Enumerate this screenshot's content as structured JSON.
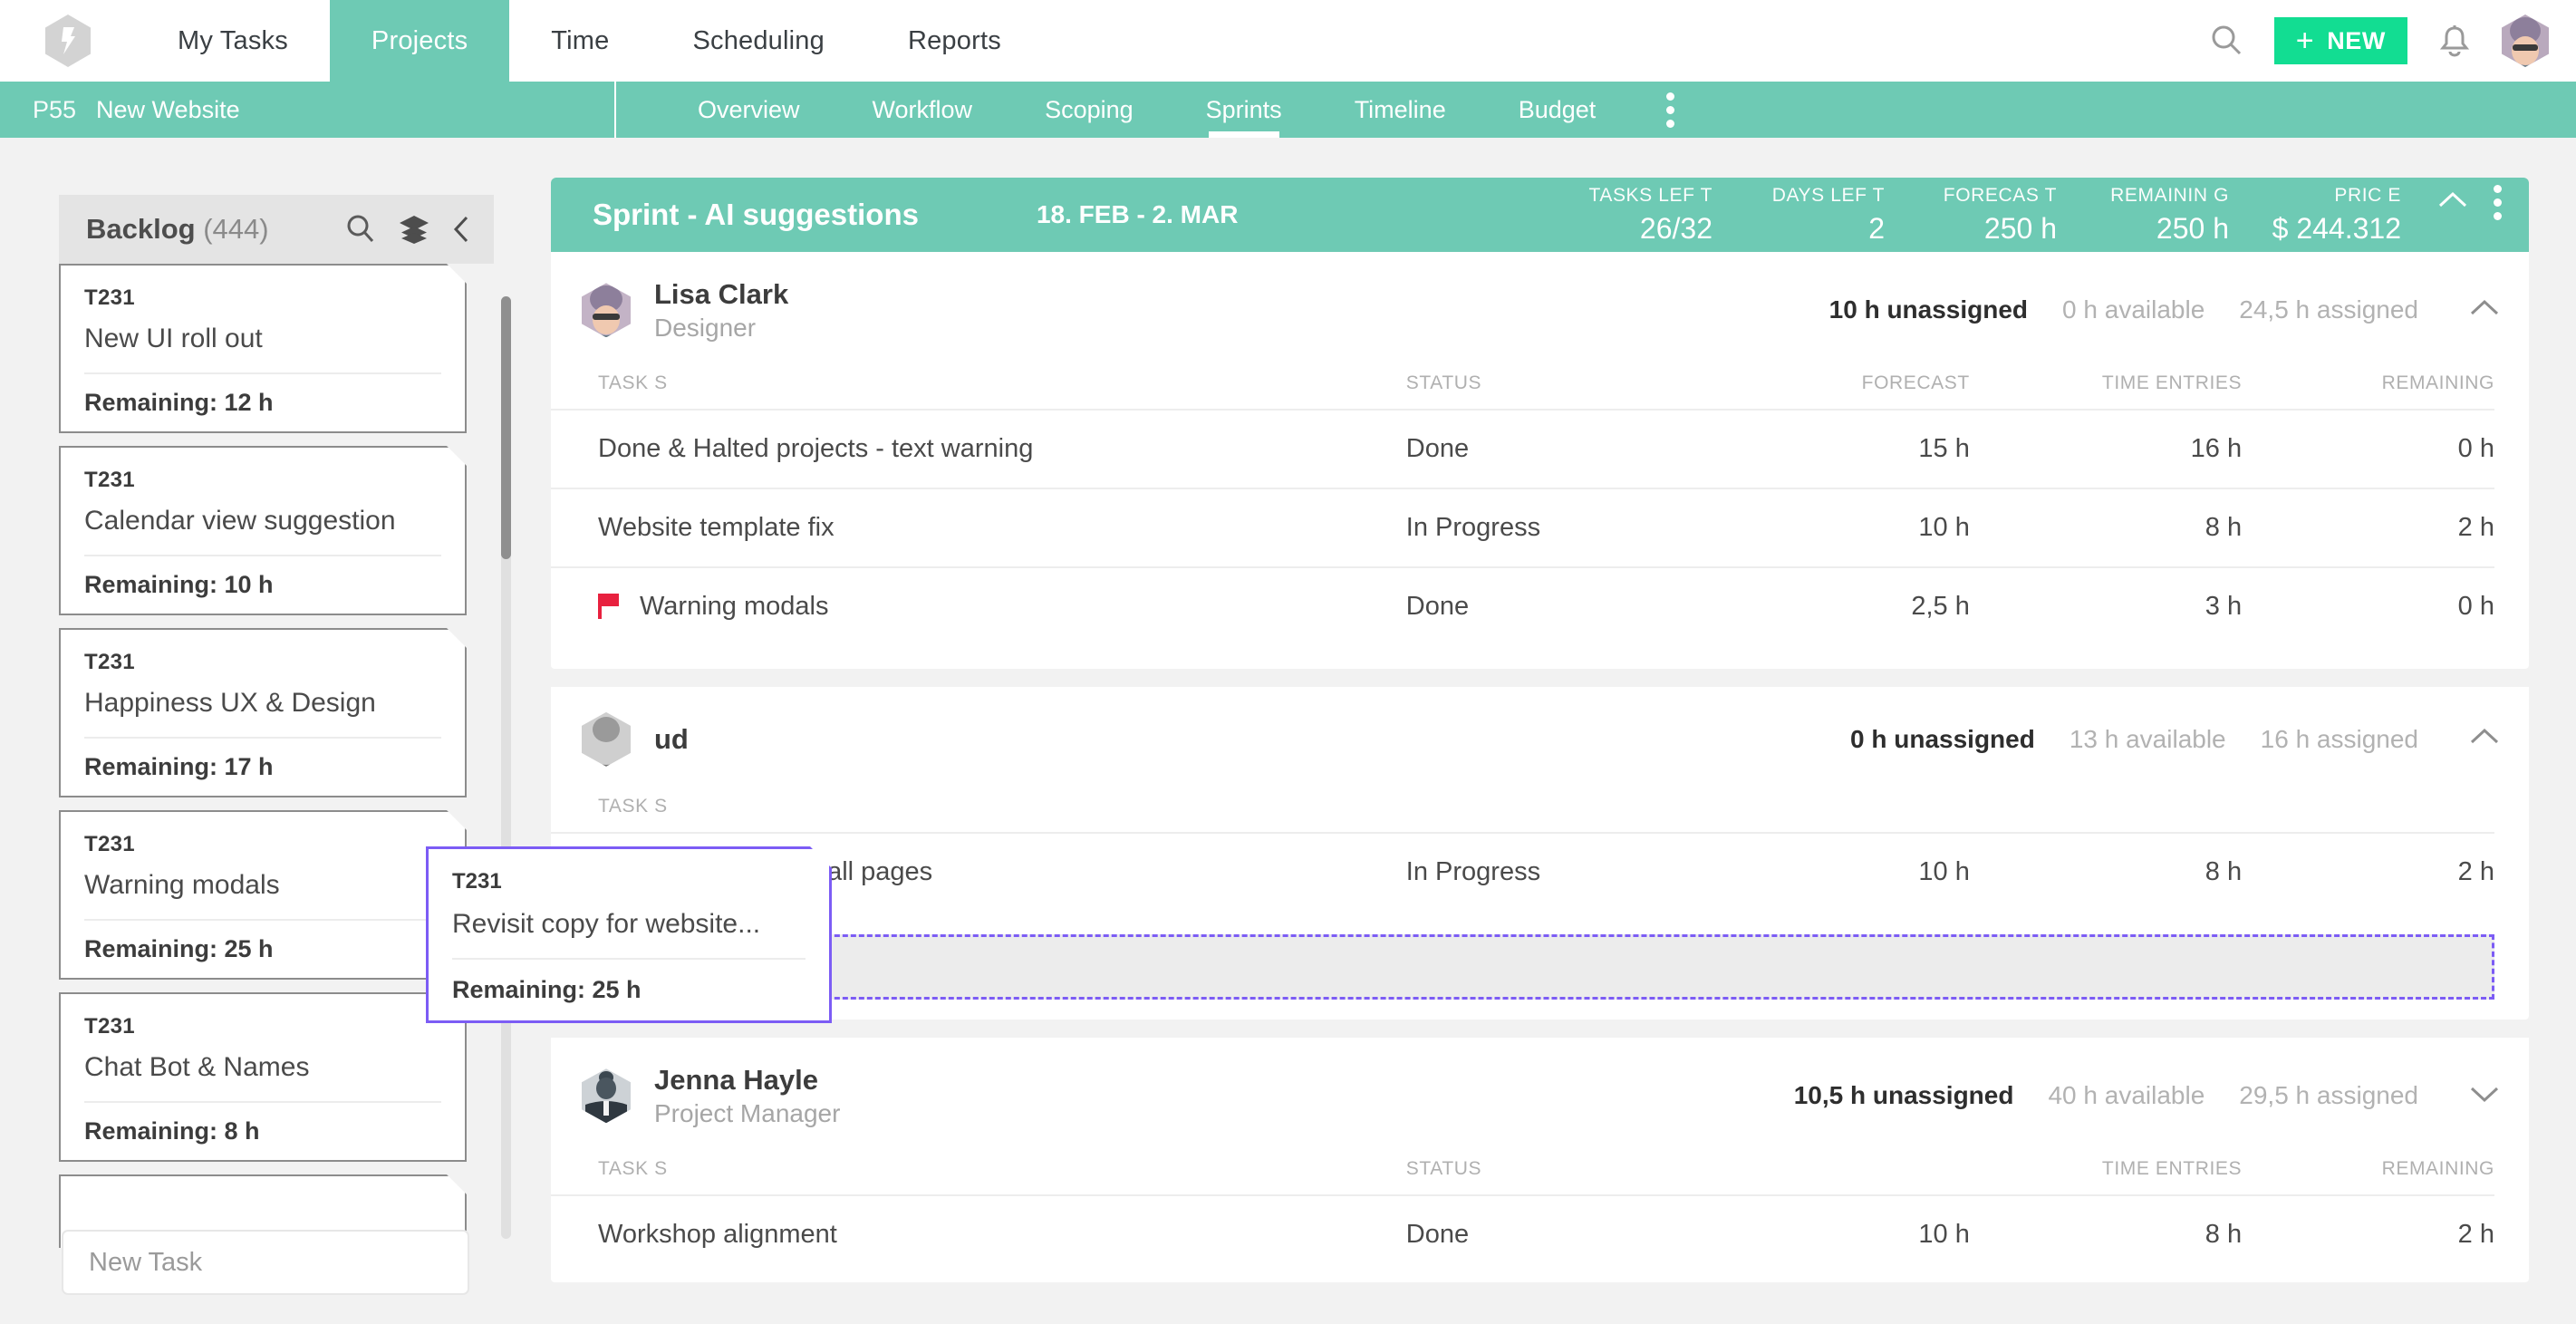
{
  "topnav": {
    "brand_icon": "forecast-logo-icon",
    "items": [
      {
        "label": "My Tasks",
        "active": false
      },
      {
        "label": "Projects",
        "active": true
      },
      {
        "label": "Time",
        "active": false
      },
      {
        "label": "Scheduling",
        "active": false
      },
      {
        "label": "Reports",
        "active": false
      }
    ],
    "search_icon": "search-icon",
    "new_button": {
      "plus": "+",
      "label": "NEW"
    },
    "bell_icon": "bell-icon",
    "avatar": "user-avatar"
  },
  "subnav": {
    "project_id": "P55",
    "project_name": "New Website",
    "tabs": [
      {
        "label": "Overview",
        "active": false
      },
      {
        "label": "Workflow",
        "active": false
      },
      {
        "label": "Scoping",
        "active": false
      },
      {
        "label": "Sprints",
        "active": true
      },
      {
        "label": "Timeline",
        "active": false
      },
      {
        "label": "Budget",
        "active": false
      }
    ],
    "kebab_icon": "more-vertical-icon"
  },
  "sidebar": {
    "title": "Backlog",
    "count": "(444)",
    "search_icon": "search-icon",
    "layers_icon": "layers-icon",
    "collapse_icon": "chevron-left-icon",
    "cards": [
      {
        "id": "T231",
        "title": "New UI roll out",
        "remaining": "Remaining: 12 h"
      },
      {
        "id": "T231",
        "title": "Calendar view suggestion",
        "remaining": "Remaining: 10 h"
      },
      {
        "id": "T231",
        "title": "Happiness UX & Design",
        "remaining": "Remaining: 17 h"
      },
      {
        "id": "T231",
        "title": "Warning modals",
        "remaining": "Remaining: 25 h"
      },
      {
        "id": "T231",
        "title": "Chat Bot & Names",
        "remaining": "Remaining: 8 h"
      }
    ],
    "new_task_placeholder": "New Task"
  },
  "drag_card": {
    "id": "T231",
    "title": "Revisit copy for website...",
    "remaining": "Remaining: 25 h",
    "border_color": "#7c5cf5"
  },
  "sprint": {
    "name": "Sprint - AI suggestions",
    "dates": "18. FEB - 2. MAR",
    "accent_color": "#6ecab4",
    "collapse_icon": "chevron-up-icon",
    "kebab_icon": "more-vertical-icon",
    "metrics": [
      {
        "label": "TASKS LEF T",
        "value": "26/32"
      },
      {
        "label": "DAYS LEF T",
        "value": "2"
      },
      {
        "label": "FORECAS T",
        "value": "250 h"
      },
      {
        "label": "REMAININ G",
        "value": "250 h"
      },
      {
        "label": "PRIC E",
        "value": "$ 244.312"
      }
    ]
  },
  "columns": {
    "task": "TASK S",
    "status": "STATUS",
    "forecast": "FORECAST",
    "time_entries": "TIME ENTRIES",
    "remaining": "REMAINING"
  },
  "people": [
    {
      "name": "Lisa Clark",
      "role": "Designer",
      "unassigned": "10 h unassigned",
      "available": "0 h available",
      "assigned": "24,5 h assigned",
      "chevron": "chevron-up-icon",
      "rows": [
        {
          "flag": false,
          "task": "Done & Halted projects - text warning",
          "status": "Done",
          "forecast": "15 h",
          "time_entries": "16 h",
          "remaining": "0 h"
        },
        {
          "flag": false,
          "task": "Website template fix",
          "status": "In Progress",
          "forecast": "10 h",
          "time_entries": "8 h",
          "remaining": "2 h"
        },
        {
          "flag": true,
          "task": "Warning modals",
          "status": "Done",
          "forecast": "2,5 h",
          "time_entries": "3 h",
          "remaining": "0 h"
        }
      ]
    },
    {
      "name": "ud",
      "role": "",
      "unassigned": "0 h unassigned",
      "available": "13 h available",
      "assigned": "16 h assigned",
      "chevron": "chevron-up-icon",
      "rows": [
        {
          "flag": false,
          "task": "Tailor made chat to all pages",
          "status": "In Progress",
          "forecast": "10 h",
          "time_entries": "8 h",
          "remaining": "2 h"
        }
      ],
      "dropzone": true
    },
    {
      "name": "Jenna Hayle",
      "role": "Project Manager",
      "unassigned": "10,5 h unassigned",
      "available": "40 h available",
      "assigned": "29,5 h assigned",
      "chevron": "chevron-down-icon",
      "rows": [
        {
          "flag": false,
          "task": "Workshop alignment",
          "status": "Done",
          "forecast": "10 h",
          "time_entries": "8 h",
          "remaining": "2 h"
        }
      ]
    }
  ]
}
